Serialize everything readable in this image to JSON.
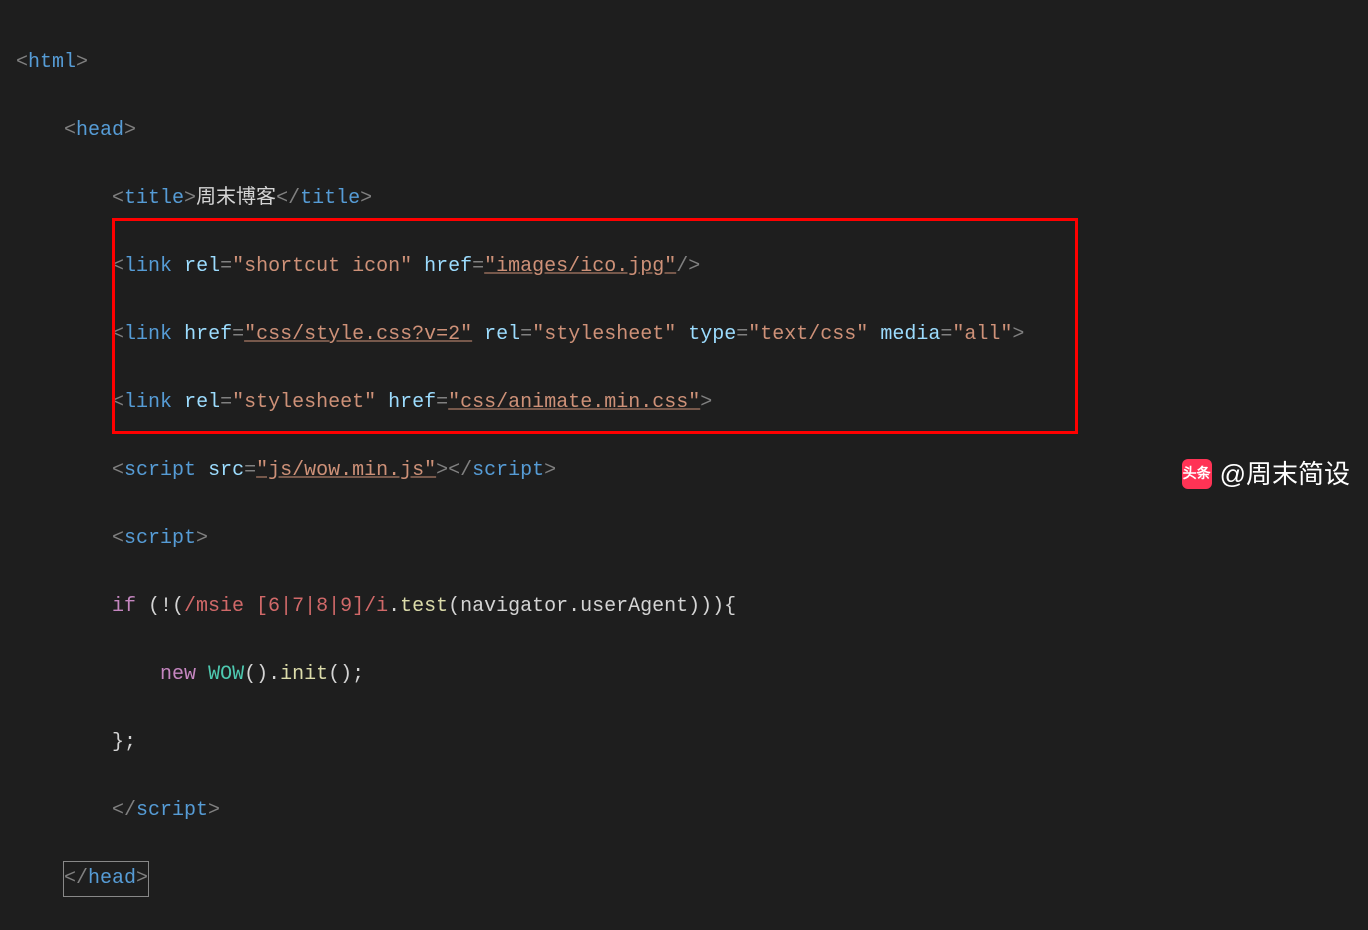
{
  "code": {
    "line1": {
      "open": "<",
      "tag": "html",
      "close": ">"
    },
    "line2": {
      "indent": "    ",
      "open": "<",
      "tag": "head",
      "close": ">"
    },
    "line3": {
      "indent": "        ",
      "open": "<",
      "tag": "title",
      "close": ">",
      "text": "周末博客",
      "open2": "</",
      "tag2": "title",
      "close2": ">"
    },
    "line4": {
      "indent": "        ",
      "open": "<",
      "tag": "link",
      "attr1": "rel",
      "eq": "=",
      "val1": "\"shortcut icon\"",
      "attr2": "href",
      "val2": "\"images/ico.jpg\"",
      "selfclose": "/>"
    },
    "line5": {
      "indent": "        ",
      "open": "<",
      "tag": "link",
      "attr1": "href",
      "val1": "\"css/style.css?v=2\"",
      "attr2": "rel",
      "val2": "\"stylesheet\"",
      "attr3": "type",
      "val3": "\"text/css\"",
      "attr4": "media",
      "val4": "\"all\"",
      "close": ">"
    },
    "line6": {
      "indent": "        ",
      "open": "<",
      "tag": "link",
      "attr1": "rel",
      "val1": "\"stylesheet\"",
      "attr2": "href",
      "val2": "\"css/animate.min.css\"",
      "close": ">"
    },
    "line7": {
      "indent": "        ",
      "open": "<",
      "tag": "script",
      "attr1": "src",
      "val1": "\"js/wow.min.js\"",
      "close": ">",
      "open2": "</",
      "tag2": "script",
      "close2": ">"
    },
    "line8": {
      "indent": "        ",
      "open": "<",
      "tag": "script",
      "close": ">"
    },
    "line9": {
      "indent": "        ",
      "kw": "if",
      "text1": " (!(",
      "regex": "/msie [6|7|8|9]/i",
      "text2": ".",
      "func": "test",
      "text3": "(navigator.userAgent))){"
    },
    "line10": {
      "indent": "            ",
      "kw": "new",
      "space": " ",
      "class": "WOW",
      "text": "().",
      "func": "init",
      "text2": "();"
    },
    "line11": {
      "indent": "        ",
      "text": "};"
    },
    "line12": {
      "indent": "        ",
      "open": "</",
      "tag": "script",
      "close": ">"
    },
    "line13": {
      "indent": "    ",
      "open": "</",
      "tag": "head",
      "close": ">"
    }
  },
  "watermark": {
    "icon_text": "头条",
    "text": "@周末简设"
  }
}
